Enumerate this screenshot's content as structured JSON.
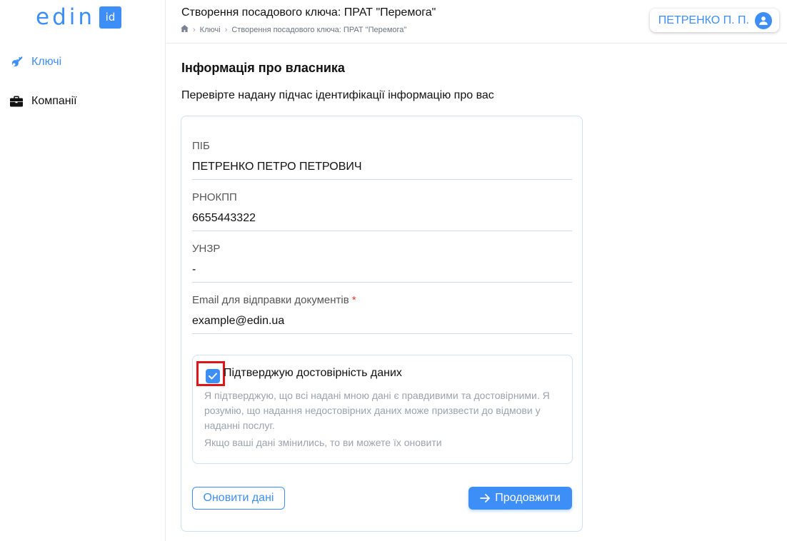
{
  "app": {
    "logo_text": "edin",
    "logo_badge": "id"
  },
  "sidebar": {
    "items": [
      {
        "label": "Ключі",
        "icon": "key-icon",
        "active": true
      },
      {
        "label": "Компанії",
        "icon": "briefcase-icon",
        "active": false
      }
    ]
  },
  "header": {
    "title": "Створення посадового ключа: ПРАТ \"Перемога\"",
    "breadcrumb": [
      "Ключі",
      "Створення посадового ключа: ПРАТ \"Перемога\""
    ],
    "user_name": "ПЕТРЕНКО П. П."
  },
  "main": {
    "section_title": "Інформація про власника",
    "section_subtitle": "Перевірте надану підчас ідентифікації інформацію про вас",
    "fields": [
      {
        "label": "ПІБ",
        "value": "ПЕТРЕНКО ПЕТРО ПЕТРОВИЧ"
      },
      {
        "label": "РНОКПП",
        "value": "6655443322"
      },
      {
        "label": "УНЗР",
        "value": "-"
      },
      {
        "label": "Email для відправки документів",
        "required_mark": "*",
        "value": "example@edin.ua"
      }
    ],
    "confirm": {
      "checked": true,
      "label": "Підтверджую достовірність даних",
      "text": "Я підтверджую, що всі надані мною дані є правдивими та достовірними. Я розумію, що надання недостовірних даних може призвести до відмови у наданні послуг.",
      "note": "Якщо ваші дані змінились, то ви можете їх оновити"
    },
    "buttons": {
      "update": "Оновити дані",
      "continue": "Продовжити"
    }
  },
  "colors": {
    "accent": "#3d8ef7",
    "highlight": "#e0141b",
    "required": "#e53935"
  }
}
